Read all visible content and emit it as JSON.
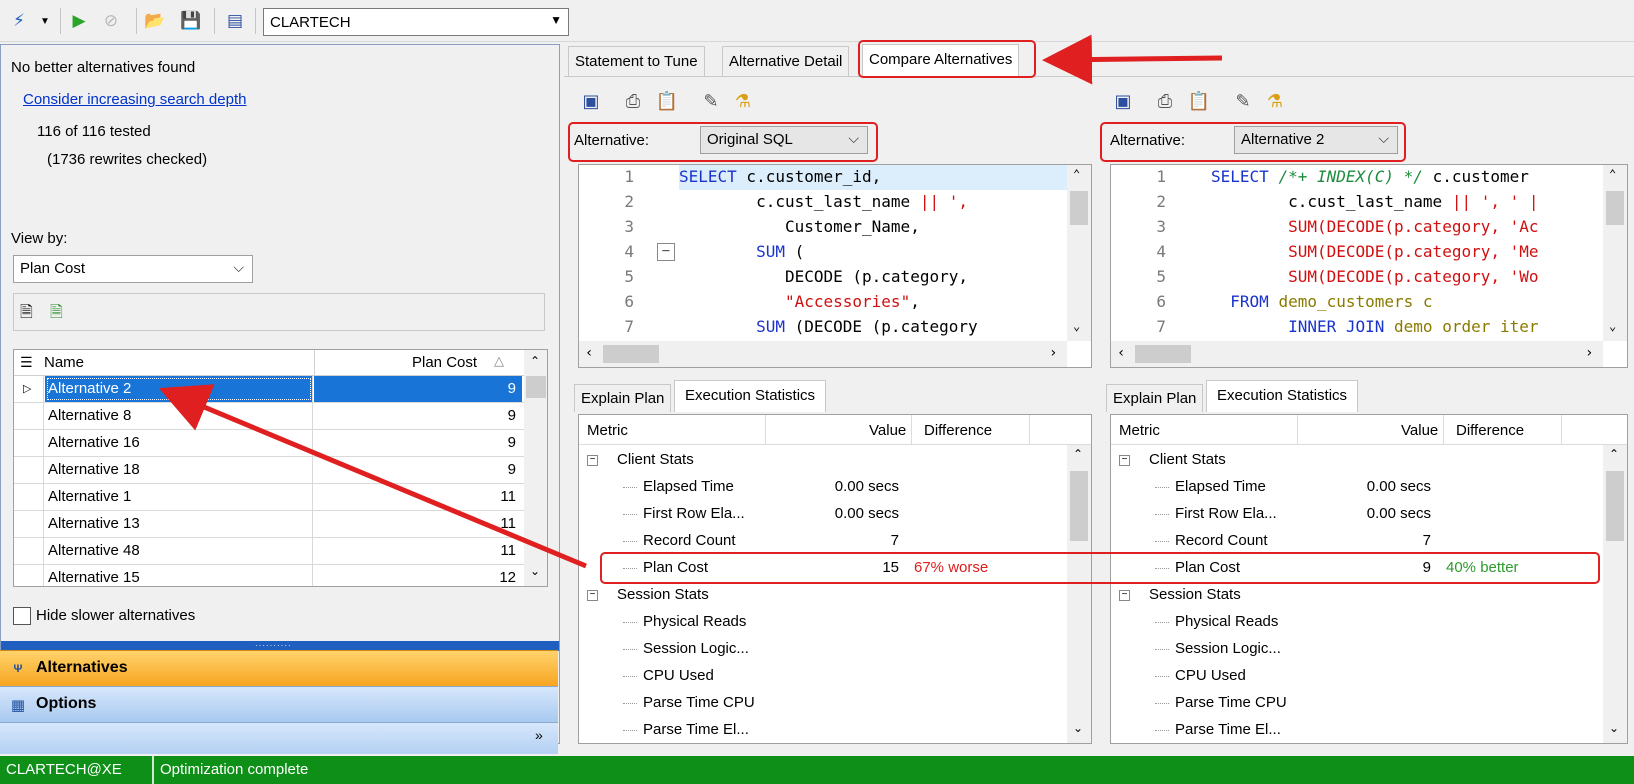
{
  "toolbar": {
    "schema": "CLARTECH"
  },
  "left": {
    "result_msg": "No better alternatives found",
    "link": "Consider increasing search depth",
    "tested": "116 of 116 tested",
    "rewrites": "(1736 rewrites checked)",
    "view_by_label": "View by:",
    "view_by_value": "Plan Cost",
    "grid": {
      "col_name": "Name",
      "col_cost": "Plan Cost",
      "rows": [
        {
          "name": "Alternative 2",
          "cost": "9"
        },
        {
          "name": "Alternative 8",
          "cost": "9"
        },
        {
          "name": "Alternative 16",
          "cost": "9"
        },
        {
          "name": "Alternative 18",
          "cost": "9"
        },
        {
          "name": "Alternative 1",
          "cost": "11"
        },
        {
          "name": "Alternative 13",
          "cost": "11"
        },
        {
          "name": "Alternative 48",
          "cost": "11"
        },
        {
          "name": "Alternative 15",
          "cost": "12"
        }
      ]
    },
    "hide_slower": "Hide slower alternatives",
    "nav_alternatives": "Alternatives",
    "nav_options": "Options"
  },
  "tabs": {
    "statement": "Statement to Tune",
    "detail": "Alternative Detail",
    "compare": "Compare Alternatives"
  },
  "compare": {
    "alt_label": "Alternative:",
    "left_alt": "Original SQL",
    "right_alt": "Alternative 2",
    "sub_tab_explain": "Explain Plan",
    "sub_tab_exec": "Execution Statistics",
    "col_metric": "Metric",
    "col_value": "Value",
    "col_diff": "Difference",
    "group_client": "Client Stats",
    "group_session": "Session Stats",
    "left_stats": [
      {
        "metric": "Elapsed Time",
        "value": "0.00 secs",
        "diff": ""
      },
      {
        "metric": "First Row Ela...",
        "value": "0.00 secs",
        "diff": ""
      },
      {
        "metric": "Record Count",
        "value": "7",
        "diff": ""
      },
      {
        "metric": "Plan Cost",
        "value": "15",
        "diff": "67% worse"
      }
    ],
    "right_stats": [
      {
        "metric": "Elapsed Time",
        "value": "0.00 secs",
        "diff": ""
      },
      {
        "metric": "First Row Ela...",
        "value": "0.00 secs",
        "diff": ""
      },
      {
        "metric": "Record Count",
        "value": "7",
        "diff": ""
      },
      {
        "metric": "Plan Cost",
        "value": "9",
        "diff": "40% better"
      }
    ],
    "left_session": [
      "Physical Reads",
      "Session Logic...",
      "CPU Used",
      "Parse Time CPU",
      "Parse Time El..."
    ],
    "right_session": [
      "Physical Reads",
      "Session Logic...",
      "CPU Used",
      "Parse Time CPU",
      "Parse Time El..."
    ]
  },
  "status": {
    "connection": "CLARTECH@XE",
    "message": "Optimization complete"
  }
}
